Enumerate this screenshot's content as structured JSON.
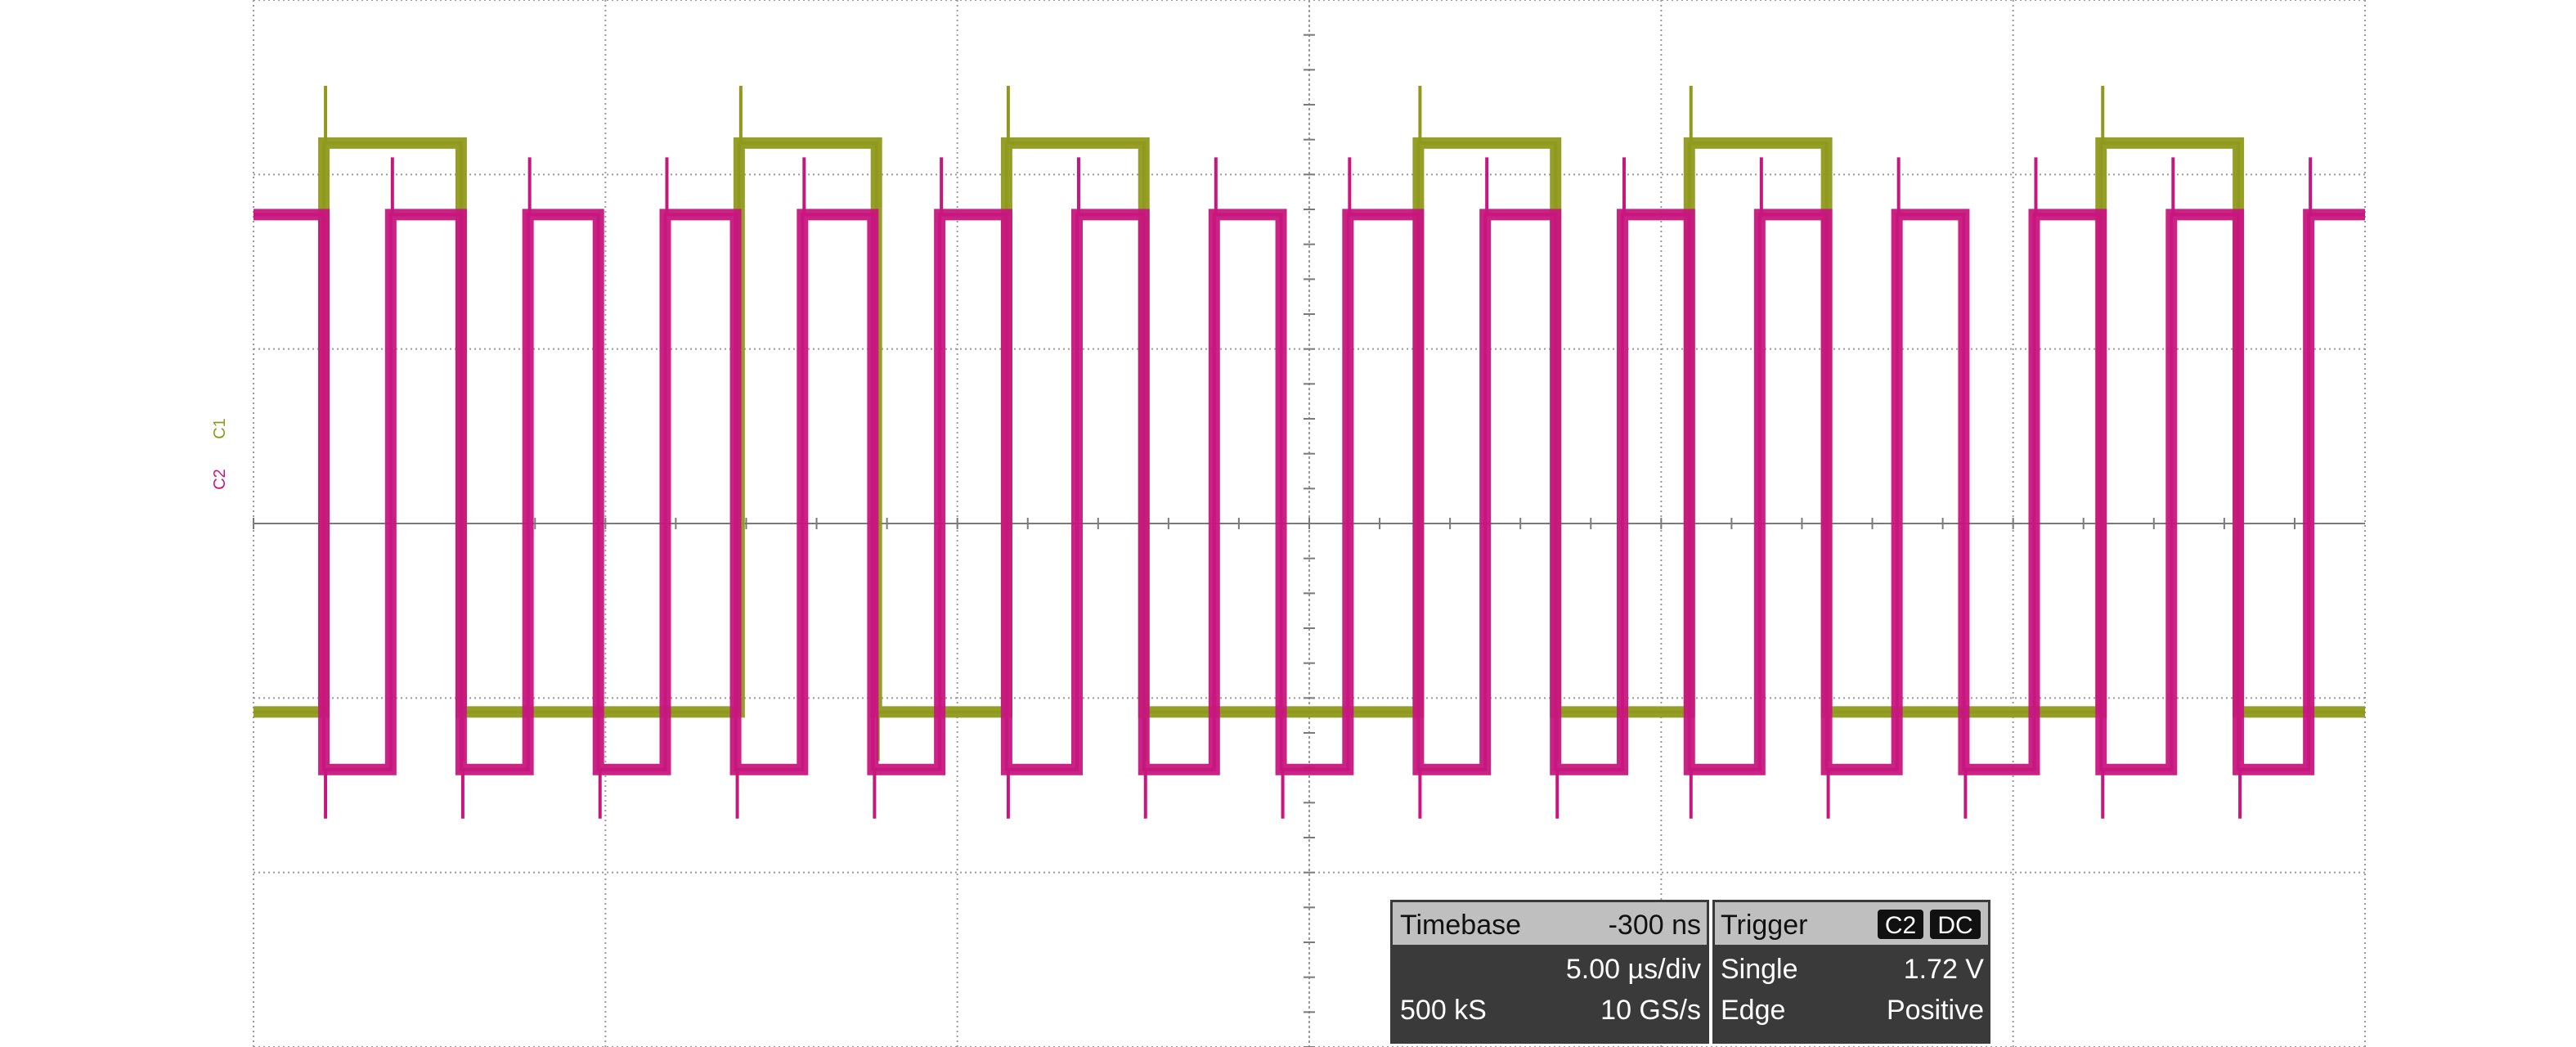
{
  "channels": [
    {
      "id": "C1",
      "label": "C1",
      "color": "#8f9a1c"
    },
    {
      "id": "C2",
      "label": "C2",
      "color": "#c7167e"
    }
  ],
  "timebase": {
    "title": "Timebase",
    "delay": "-300 ns",
    "per_div": "5.00 µs/div",
    "samples": "500 kS",
    "rate": "10 GS/s"
  },
  "trigger": {
    "title": "Trigger",
    "source_badge": "C2",
    "coupling_badge": "DC",
    "mode": "Single",
    "level": "1.72 V",
    "type": "Edge",
    "slope": "Positive"
  },
  "chart_data": {
    "type": "line",
    "grid": true,
    "x_divisions": 6,
    "y_divisions": 6,
    "x_unit_per_div": "5.00 µs/div",
    "xlim": [
      0,
      6
    ],
    "ylim": [
      -3,
      3
    ],
    "series": [
      {
        "name": "C1",
        "color": "#8f9a1c",
        "high": 2.18,
        "low": -1.08,
        "edges": [
          0.2,
          0.59,
          1.38,
          1.77,
          2.14,
          2.53,
          3.31,
          3.7,
          4.08,
          4.47,
          5.25,
          5.64
        ],
        "start_level": "low",
        "end_x": 6.0
      },
      {
        "name": "C2",
        "color": "#c7167e",
        "high": 1.77,
        "low": -1.41,
        "edges": [
          0.2,
          0.39,
          0.59,
          0.78,
          0.98,
          1.17,
          1.37,
          1.56,
          1.76,
          1.95,
          2.14,
          2.34,
          2.53,
          2.73,
          2.92,
          3.11,
          3.31,
          3.5,
          3.7,
          3.89,
          4.08,
          4.28,
          4.47,
          4.67,
          4.86,
          5.06,
          5.25,
          5.45,
          5.64,
          5.84
        ],
        "start_level": "high",
        "end_x": 6.0
      }
    ]
  }
}
